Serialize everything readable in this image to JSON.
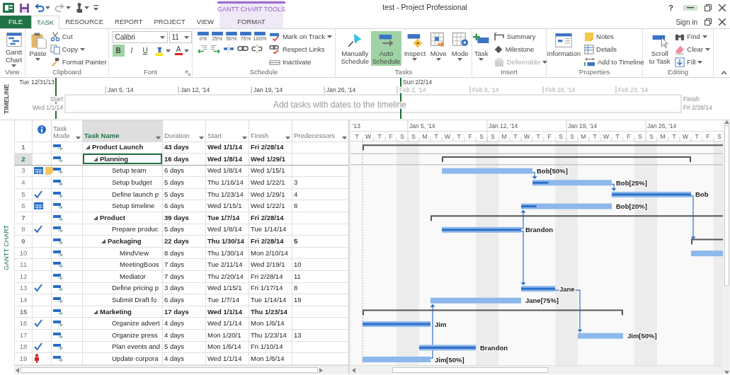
{
  "title_bar": {
    "title": "test - Project Professional",
    "help": "?",
    "minimize_hovered": true
  },
  "context_tab": {
    "title": "GANTT CHART TOOLS"
  },
  "tabs": [
    {
      "label": "FILE",
      "kind": "file",
      "selected": false
    },
    {
      "label": "TASK",
      "kind": "normal",
      "selected": true
    },
    {
      "label": "RESOURCE",
      "kind": "normal",
      "selected": false
    },
    {
      "label": "REPORT",
      "kind": "normal",
      "selected": false
    },
    {
      "label": "PROJECT",
      "kind": "normal",
      "selected": false
    },
    {
      "label": "VIEW",
      "kind": "normal",
      "selected": false
    },
    {
      "label": "FORMAT",
      "kind": "context",
      "selected": false
    }
  ],
  "account": {
    "label": "Sign in"
  },
  "ribbon": {
    "groups": [
      {
        "label": "View",
        "columns": [
          [
            [
              {
                "kind": "large",
                "label": "Gantt Chart",
                "dropdown": true
              }
            ]
          ]
        ]
      },
      {
        "label": "Clipboard",
        "columns": [
          [
            [
              {
                "kind": "large",
                "label": "Paste",
                "dropdown": true
              }
            ]
          ],
          [
            [
              {
                "kind": "small",
                "label": "Cut"
              }
            ],
            [
              {
                "kind": "small",
                "label": "Copy",
                "dropdown": true
              }
            ],
            [
              {
                "kind": "small",
                "label": "Format Painter"
              }
            ]
          ]
        ]
      },
      {
        "label": "Font",
        "dialog": true,
        "columns": [
          [
            [
              {
                "kind": "select",
                "value": "Calibri"
              },
              {
                "kind": "select",
                "value": "11"
              }
            ],
            [
              {
                "kind": "format",
                "label": "B",
                "selected": true
              },
              {
                "kind": "format",
                "label": "I",
                "selected": false
              },
              {
                "kind": "format",
                "label": "U",
                "selected": false
              },
              {
                "kind": "color",
                "color": "#f5e400",
                "dropdown": true
              },
              {
                "kind": "color",
                "label": "A",
                "color": "#e02020",
                "dropdown": true
              }
            ]
          ]
        ]
      },
      {
        "label": "Schedule",
        "columns": [
          [
            [
              {
                "kind": "percent",
                "label": "0%"
              },
              {
                "kind": "percent",
                "label": "25%"
              },
              {
                "kind": "percent",
                "label": "50%"
              },
              {
                "kind": "percent",
                "label": "75%"
              },
              {
                "kind": "percent",
                "label": "100%"
              }
            ],
            [
              {
                "kind": "tool"
              },
              {
                "kind": "tool"
              },
              {
                "kind": "tool"
              },
              {
                "kind": "tool"
              },
              {
                "kind": "tool"
              }
            ]
          ],
          [
            [
              {
                "kind": "small",
                "label": "Mark on Track",
                "dropdown": true
              }
            ],
            [
              {
                "kind": "small",
                "label": "Respect Links"
              }
            ],
            [
              {
                "kind": "small",
                "label": "Inactivate"
              }
            ]
          ]
        ]
      },
      {
        "label": "Tasks",
        "columns": [
          [
            [
              {
                "kind": "large",
                "label": "Manually Schedule",
                "selected": false
              }
            ]
          ],
          [
            [
              {
                "kind": "large",
                "label": "Auto Schedule",
                "selected": true
              }
            ]
          ],
          [
            [
              {
                "kind": "large",
                "label": "Inspect",
                "dropdown": true
              }
            ]
          ],
          [
            [
              {
                "kind": "large",
                "label": "Move",
                "dropdown": true
              }
            ]
          ],
          [
            [
              {
                "kind": "large",
                "label": "Mode",
                "dropdown": true
              }
            ]
          ]
        ]
      },
      {
        "label": "Insert",
        "columns": [
          [
            [
              {
                "kind": "large",
                "label": "Task",
                "dropdown": true
              }
            ]
          ],
          [
            [
              {
                "kind": "small",
                "label": "Summary"
              }
            ],
            [
              {
                "kind": "small",
                "label": "Milestone"
              }
            ],
            [
              {
                "kind": "small",
                "label": "Deliverable",
                "dropdown": true,
                "disabled": true
              }
            ]
          ]
        ]
      },
      {
        "label": "Properties",
        "columns": [
          [
            [
              {
                "kind": "large",
                "label": "Information"
              }
            ]
          ],
          [
            [
              {
                "kind": "small",
                "label": "Notes"
              }
            ],
            [
              {
                "kind": "small",
                "label": "Details"
              }
            ],
            [
              {
                "kind": "small",
                "label": "Add to Timeline"
              }
            ]
          ]
        ]
      },
      {
        "label": "Editing",
        "columns": [
          [
            [
              {
                "kind": "large",
                "label": "Scroll to Task"
              }
            ]
          ],
          [
            [
              {
                "kind": "small",
                "label": "Find",
                "dropdown": true
              }
            ],
            [
              {
                "kind": "small",
                "label": "Clear",
                "dropdown": true
              }
            ],
            [
              {
                "kind": "small",
                "label": "Fill",
                "dropdown": true
              }
            ]
          ]
        ]
      }
    ]
  },
  "timeline": {
    "label": "TIMELINE",
    "view_start": "Tue 12/31/13",
    "view_end": "Sun 2/2/14",
    "ticks": [
      {
        "label": "Jan 5, '14",
        "in_view": true
      },
      {
        "label": "Jan 12, '14",
        "in_view": true
      },
      {
        "label": "Jan 19, '14",
        "in_view": true
      },
      {
        "label": "Jan 26, '14",
        "in_view": true
      },
      {
        "label": "Feb 2, '14",
        "in_view": false
      },
      {
        "label": "Feb 9, '14",
        "in_view": false
      },
      {
        "label": "Feb 16, '14",
        "in_view": false
      },
      {
        "label": "Feb 23, '14",
        "in_view": false
      }
    ],
    "start_label": "Start",
    "start_date": "Wed 1/1/14",
    "finish_label": "Finish",
    "finish_date": "Fri 2/28/14",
    "hint": "Add tasks with dates to the timeline"
  },
  "side_label": "GANTT CHART",
  "columns": [
    {
      "label": "Task Mode",
      "selected": false
    },
    {
      "label": "Task Name",
      "selected": true
    },
    {
      "label": "Duration",
      "selected": false
    },
    {
      "label": "Start",
      "selected": false
    },
    {
      "label": "Finish",
      "selected": false
    },
    {
      "label": "Predecessors",
      "selected": false
    }
  ],
  "tasks": [
    {
      "id": "1",
      "name": "Product Launch",
      "duration": "43 days",
      "start": "Wed 1/1/14",
      "finish": "Fri 2/28/14",
      "selected": false,
      "complete": false,
      "calendar": false,
      "note": false,
      "overallocated": false,
      "expanded": true,
      "children": [
        {
          "id": "2",
          "name": "Planning",
          "duration": "16 days",
          "start": "Wed 1/8/14",
          "finish": "Wed 1/29/1",
          "selected": true,
          "complete": false,
          "calendar": false,
          "note": false,
          "overallocated": false,
          "expanded": true,
          "children": [
            {
              "id": "3",
              "name": "Setup team",
              "duration": "6 days",
              "start": "Wed 1/8/14",
              "finish": "Wed 1/15/1",
              "resource": "Bob[50%]",
              "selected": false,
              "complete": false,
              "calendar": true,
              "note": true,
              "overallocated": false
            },
            {
              "id": "4",
              "name": "Setup budget",
              "duration": "5 days",
              "start": "Thu 1/16/14",
              "finish": "Wed 1/22/1",
              "predecessors": "3",
              "resource": "Bob[25%]",
              "level": 0.2,
              "selected": false,
              "complete": false,
              "calendar": false,
              "note": false,
              "overallocated": false
            },
            {
              "id": "5",
              "name": "Define launch p",
              "duration": "5 days",
              "start": "Thu 1/23/14",
              "finish": "Wed 1/29/1",
              "predecessors": "4",
              "resource": "Bob",
              "level": 1,
              "selected": false,
              "complete": true,
              "calendar": false,
              "note": false,
              "overallocated": false
            },
            {
              "id": "6",
              "name": "Setup timeline",
              "duration": "6 days",
              "start": "Wed 1/15/1",
              "finish": "Wed 1/22/1",
              "predecessors": "8",
              "resource": "Bob[20%]",
              "level": 0.17,
              "selected": false,
              "complete": false,
              "calendar": true,
              "note": false,
              "overallocated": false
            }
          ]
        },
        {
          "id": "7",
          "name": "Product",
          "duration": "39 days",
          "start": "Tue 1/7/14",
          "finish": "Fri 2/28/14",
          "selected": false,
          "complete": false,
          "calendar": false,
          "note": false,
          "overallocated": false,
          "expanded": true,
          "children": [
            {
              "id": "8",
              "name": "Prepare produc",
              "duration": "5 days",
              "start": "Wed 1/8/14",
              "finish": "Tue 1/14/14",
              "resource": "Brandon",
              "level": 1,
              "selected": false,
              "complete": true,
              "calendar": false,
              "note": false,
              "overallocated": false
            },
            {
              "id": "9",
              "name": "Packaging",
              "duration": "22 days",
              "start": "Thu 1/30/14",
              "finish": "Fri 2/28/14",
              "predecessors": "5",
              "selected": false,
              "complete": false,
              "calendar": false,
              "note": false,
              "overallocated": false,
              "expanded": true,
              "children": [
                {
                  "id": "10",
                  "name": "MindView",
                  "duration": "8 days",
                  "start": "Thu 1/30/14",
                  "finish": "Mon 2/10/14",
                  "selected": false,
                  "complete": false,
                  "calendar": false,
                  "note": false,
                  "overallocated": false
                },
                {
                  "id": "11",
                  "name": "MeetingBoos",
                  "duration": "7 days",
                  "start": "Tue 2/11/14",
                  "finish": "Wed 2/19/1",
                  "predecessors": "10",
                  "selected": false,
                  "complete": false,
                  "calendar": false,
                  "note": false,
                  "overallocated": false
                },
                {
                  "id": "12",
                  "name": "Mediator",
                  "duration": "7 days",
                  "start": "Thu 2/20/14",
                  "finish": "Fri 2/28/14",
                  "predecessors": "11",
                  "selected": false,
                  "complete": false,
                  "calendar": false,
                  "note": false,
                  "overallocated": false
                }
              ]
            },
            {
              "id": "13",
              "name": "Define pricing p",
              "duration": "3 days",
              "start": "Wed 1/15/1",
              "finish": "Fri 1/17/14",
              "predecessors": "8",
              "resource": "Jane",
              "level": 1,
              "selected": false,
              "complete": true,
              "calendar": false,
              "note": false,
              "overallocated": false
            },
            {
              "id": "14",
              "name": "Submit Draft fo",
              "duration": "6 days",
              "start": "Tue 1/7/14",
              "finish": "Tue 1/14/14",
              "predecessors": "19",
              "resource": "Jane[75%]",
              "selected": false,
              "complete": false,
              "calendar": false,
              "note": false,
              "overallocated": false
            }
          ]
        },
        {
          "id": "15",
          "name": "Marketing",
          "duration": "17 days",
          "start": "Wed 1/1/14",
          "finish": "Thu 1/23/14",
          "selected": false,
          "complete": false,
          "calendar": false,
          "note": false,
          "overallocated": false,
          "expanded": true,
          "children": [
            {
              "id": "16",
              "name": "Organize advert",
              "duration": "4 days",
              "start": "Wed 1/1/14",
              "finish": "Mon 1/6/14",
              "resource": "Jim",
              "level": 1,
              "selected": false,
              "complete": true,
              "calendar": false,
              "note": false,
              "overallocated": false
            },
            {
              "id": "17",
              "name": "Organize press",
              "duration": "4 days",
              "start": "Mon 1/20/1",
              "finish": "Thu 1/23/14",
              "predecessors": "13",
              "resource": "Jim[50%]",
              "selected": false,
              "complete": false,
              "calendar": false,
              "note": false,
              "overallocated": false
            },
            {
              "id": "18",
              "name": "Plan events and",
              "duration": "5 days",
              "start": "Mon 1/6/14",
              "finish": "Fri 1/10/14",
              "resource": "Brandon",
              "level": 1,
              "selected": false,
              "complete": true,
              "calendar": false,
              "note": false,
              "overallocated": false
            },
            {
              "id": "19",
              "name": "Update corpora",
              "duration": "4 days",
              "start": "Wed 1/1/14",
              "finish": "Mon 1/6/14",
              "resource": "Jim[50%]",
              "selected": false,
              "complete": false,
              "calendar": false,
              "note": false,
              "overallocated": true
            }
          ]
        }
      ]
    }
  ],
  "gantt": {
    "weeks": [
      "'13",
      "Jan 5, '14",
      "Jan 12, '14",
      "Jan 19, '14",
      "Jan 26, '14"
    ],
    "days": [
      {
        "label": "T",
        "nonworking": false
      },
      {
        "label": "W",
        "nonworking": false
      },
      {
        "label": "T",
        "nonworking": false
      },
      {
        "label": "F",
        "nonworking": false
      },
      {
        "label": "S",
        "nonworking": true
      },
      {
        "label": "S",
        "nonworking": true
      },
      {
        "label": "M",
        "nonworking": false
      },
      {
        "label": "T",
        "nonworking": false
      },
      {
        "label": "W",
        "nonworking": false
      },
      {
        "label": "T",
        "nonworking": false
      },
      {
        "label": "F",
        "nonworking": false
      },
      {
        "label": "S",
        "nonworking": true
      },
      {
        "label": "S",
        "nonworking": true
      },
      {
        "label": "M",
        "nonworking": false
      },
      {
        "label": "T",
        "nonworking": false
      },
      {
        "label": "W",
        "nonworking": false
      },
      {
        "label": "T",
        "nonworking": false
      },
      {
        "label": "F",
        "nonworking": false
      },
      {
        "label": "S",
        "nonworking": true
      },
      {
        "label": "S",
        "nonworking": true
      },
      {
        "label": "M",
        "nonworking": false
      },
      {
        "label": "T",
        "nonworking": false
      },
      {
        "label": "W",
        "nonworking": false
      },
      {
        "label": "T",
        "nonworking": false
      },
      {
        "label": "F",
        "nonworking": false
      },
      {
        "label": "S",
        "nonworking": true
      },
      {
        "label": "S",
        "nonworking": true
      },
      {
        "label": "M",
        "nonworking": false
      },
      {
        "label": "T",
        "nonworking": false
      },
      {
        "label": "W",
        "nonworking": false
      },
      {
        "label": "T",
        "nonworking": false
      },
      {
        "label": "F",
        "nonworking": false
      },
      {
        "label": "S",
        "nonworking": true
      }
    ]
  }
}
